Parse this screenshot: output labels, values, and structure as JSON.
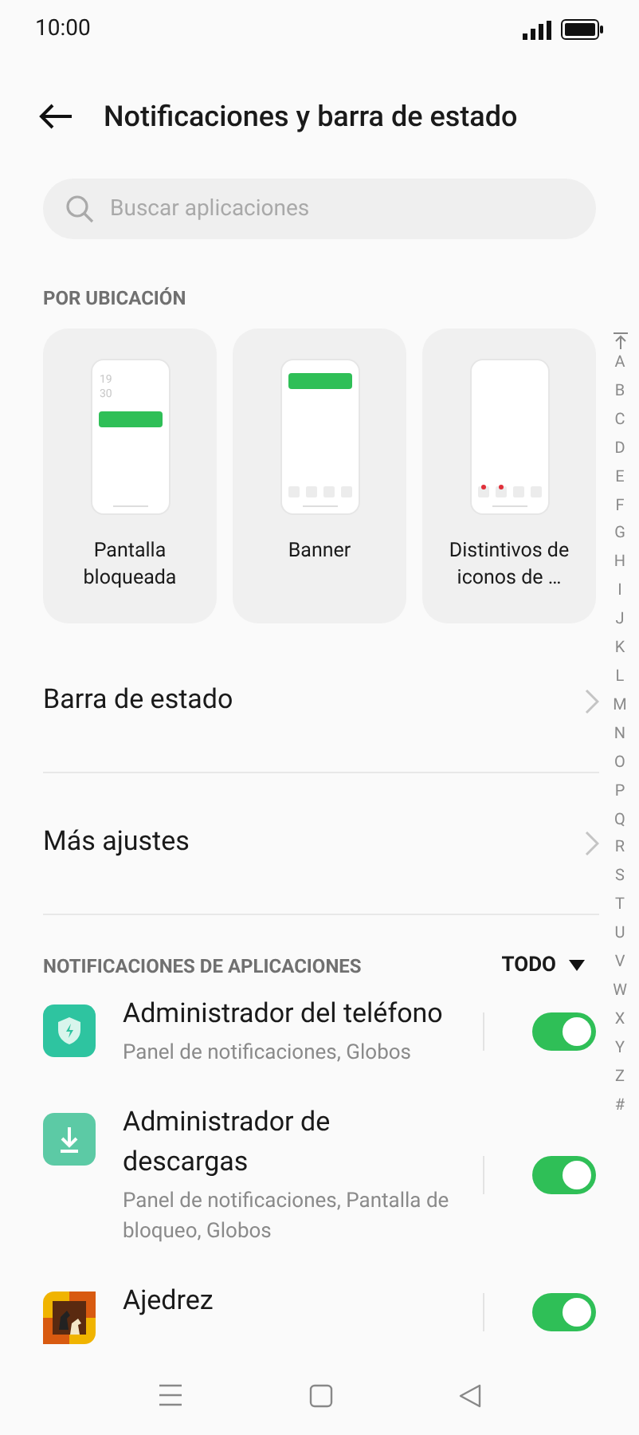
{
  "status_bar": {
    "time": "10:00"
  },
  "header": {
    "title": "Notificaciones y barra de estado"
  },
  "search": {
    "placeholder": "Buscar aplicaciones"
  },
  "location_section": {
    "title": "POR UBICACIÓN",
    "cards": [
      {
        "kind": "lock",
        "label": "Pantalla bloqueada",
        "clock": [
          "19",
          "30"
        ]
      },
      {
        "kind": "banner",
        "label": "Banner"
      },
      {
        "kind": "badges",
        "label": "Distintivos de iconos de …"
      }
    ]
  },
  "settings": [
    {
      "label": "Barra de estado"
    },
    {
      "label": "Más ajustes"
    }
  ],
  "apps_section": {
    "title": "NOTIFICACIONES DE APLICACIONES",
    "filter": "TODO",
    "apps": [
      {
        "kind": "shield",
        "name": "Administrador del teléfono",
        "detail": "Panel de notificaciones, Globos",
        "on": true
      },
      {
        "kind": "download",
        "name": "Administrador de descargas",
        "detail": "Panel de notificaciones, Pantalla de bloqueo, Globos",
        "on": true
      },
      {
        "kind": "chess",
        "name": "Ajedrez",
        "on": true
      }
    ]
  },
  "index": [
    "A",
    "B",
    "C",
    "D",
    "E",
    "F",
    "G",
    "H",
    "I",
    "J",
    "K",
    "L",
    "M",
    "N",
    "O",
    "P",
    "Q",
    "R",
    "S",
    "T",
    "U",
    "V",
    "W",
    "X",
    "Y",
    "Z",
    "#"
  ]
}
